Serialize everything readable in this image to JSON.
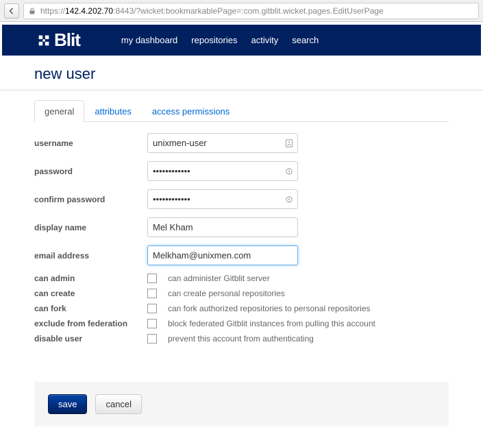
{
  "browser": {
    "url_proto": "https://",
    "url_host": "142.4.202.70",
    "url_rest": ":8443/?wicket:bookmarkablePage=:com.gitblit.wicket.pages.EditUserPage"
  },
  "logo_text": "Blit",
  "nav": {
    "dashboard": "my dashboard",
    "repositories": "repositories",
    "activity": "activity",
    "search": "search"
  },
  "page_title": "new user",
  "tabs": {
    "general": "general",
    "attributes": "attributes",
    "access": "access permissions"
  },
  "form": {
    "username_label": "username",
    "username_value": "unixmen-user",
    "password_label": "password",
    "password_value": "••••••••••••",
    "confirm_label": "confirm password",
    "confirm_value": "••••••••••••",
    "displayname_label": "display name",
    "displayname_value": "Mel Kham",
    "email_label": "email address",
    "email_value": "Melkham@unixmen.com",
    "can_admin_label": "can admin",
    "can_admin_desc": "can administer Gitblit server",
    "can_create_label": "can create",
    "can_create_desc": "can create personal repositories",
    "can_fork_label": "can fork",
    "can_fork_desc": "can fork authorized repositories to personal repositories",
    "exclude_label": "exclude from federation",
    "exclude_desc": "block federated Gitblit instances from pulling this account",
    "disable_label": "disable user",
    "disable_desc": "prevent this account from authenticating"
  },
  "buttons": {
    "save": "save",
    "cancel": "cancel"
  }
}
